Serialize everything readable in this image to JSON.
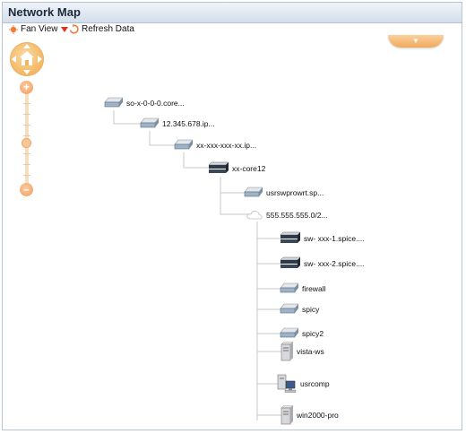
{
  "window": {
    "title": "Network Map"
  },
  "toolbar": {
    "view_label": "Fan View",
    "refresh_label": "Refresh Data"
  },
  "map": {
    "nodes": [
      {
        "label": "so-x-0-0-0.core...",
        "icon": "router-icon"
      },
      {
        "label": "12.345.678.ip...",
        "icon": "router-icon"
      },
      {
        "label": "xx-xxx-xxx-xx.ip...",
        "icon": "router-icon"
      },
      {
        "label": "xx-core12",
        "icon": "switch-stack-icon"
      },
      {
        "label": "usrswprowrt.sp...",
        "icon": "router-icon"
      },
      {
        "label": "555.555.555.0/2...",
        "icon": "cloud-icon"
      },
      {
        "label": "sw- xxx-1.spice....",
        "icon": "switch-stack-icon"
      },
      {
        "label": "sw- xxx-2.spice....",
        "icon": "switch-stack-icon"
      },
      {
        "label": "firewall",
        "icon": "router-icon"
      },
      {
        "label": "spicy",
        "icon": "router-icon"
      },
      {
        "label": "spicy2",
        "icon": "router-icon"
      },
      {
        "label": "vista-ws",
        "icon": "server-icon"
      },
      {
        "label": "usrcomp",
        "icon": "workstation-icon"
      },
      {
        "label": "win2000-pro",
        "icon": "server-icon"
      }
    ]
  },
  "colors": {
    "accent": "#f3b65f",
    "zoom": "#f09a5b",
    "titlebar": "#d4dfec",
    "connector": "#c8c8c8"
  }
}
